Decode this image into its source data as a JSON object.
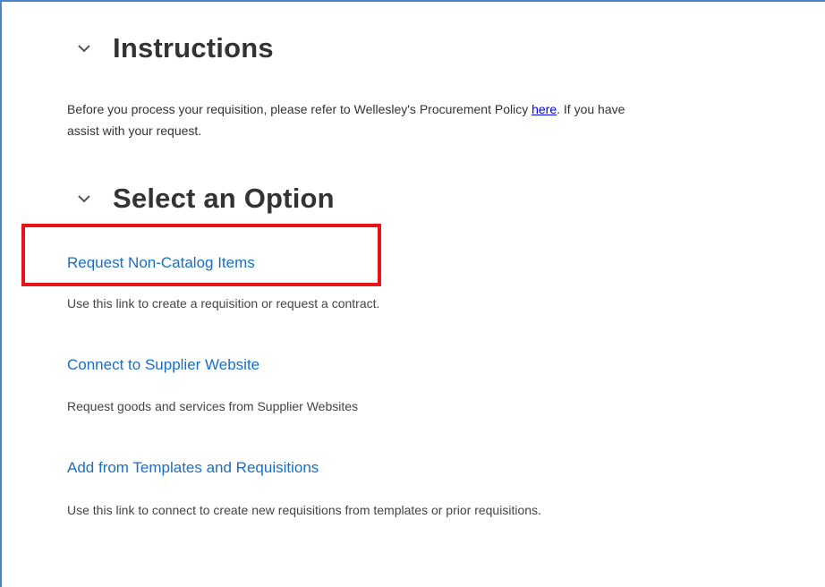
{
  "sections": {
    "instructions": {
      "title": "Instructions",
      "text_before": "Before you process your requisition, please refer to Wellesley's Procurement Policy ",
      "link_label": "here",
      "text_after": ".  If you have",
      "text_line2": "assist with your request."
    },
    "options": {
      "title": "Select an Option",
      "items": [
        {
          "label": "Request Non-Catalog Items",
          "description": "Use this link to create a requisition or request a contract."
        },
        {
          "label": "Connect to Supplier Website",
          "description": "Request goods and services from Supplier Websites"
        },
        {
          "label": "Add from Templates and Requisitions",
          "description": "Use this link to connect to create new requisitions from templates or prior requisitions."
        }
      ]
    }
  },
  "colors": {
    "link": "#1a6fc4",
    "highlight": "#e8141a",
    "frame_border": "#4a86c5"
  },
  "icons": {
    "collapse": "chevron-down-icon"
  }
}
